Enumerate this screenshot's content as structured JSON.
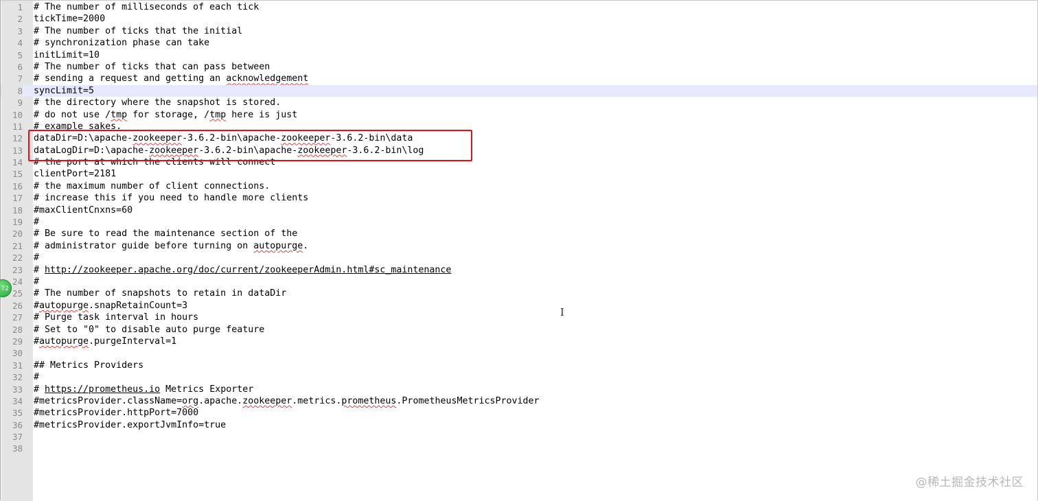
{
  "editor": {
    "current_line": 8,
    "lines": [
      {
        "n": "1",
        "text": "# The number of milliseconds of each tick"
      },
      {
        "n": "2",
        "text": "tickTime=2000"
      },
      {
        "n": "3",
        "text": "# The number of ticks that the initial"
      },
      {
        "n": "4",
        "text": "# synchronization phase can take"
      },
      {
        "n": "5",
        "text": "initLimit=10"
      },
      {
        "n": "6",
        "text": "# The number of ticks that can pass between"
      },
      {
        "n": "7",
        "text": "# sending a request and getting an acknowledgement"
      },
      {
        "n": "8",
        "text": "syncLimit=5"
      },
      {
        "n": "9",
        "text": "# the directory where the snapshot is stored."
      },
      {
        "n": "10",
        "text": "# do not use /tmp for storage, /tmp here is just"
      },
      {
        "n": "11",
        "text": "# example sakes."
      },
      {
        "n": "12",
        "text": "dataDir=D:\\apache-zookeeper-3.6.2-bin\\apache-zookeeper-3.6.2-bin\\data"
      },
      {
        "n": "13",
        "text": "dataLogDir=D:\\apache-zookeeper-3.6.2-bin\\apache-zookeeper-3.6.2-bin\\log"
      },
      {
        "n": "14",
        "text": "# the port at which the clients will connect"
      },
      {
        "n": "15",
        "text": "clientPort=2181"
      },
      {
        "n": "16",
        "text": "# the maximum number of client connections."
      },
      {
        "n": "17",
        "text": "# increase this if you need to handle more clients"
      },
      {
        "n": "18",
        "text": "#maxClientCnxns=60"
      },
      {
        "n": "19",
        "text": "#"
      },
      {
        "n": "20",
        "text": "# Be sure to read the maintenance section of the"
      },
      {
        "n": "21",
        "text": "# administrator guide before turning on autopurge."
      },
      {
        "n": "22",
        "text": "#"
      },
      {
        "n": "23",
        "text": "# http://zookeeper.apache.org/doc/current/zookeeperAdmin.html#sc_maintenance"
      },
      {
        "n": "24",
        "text": "#"
      },
      {
        "n": "25",
        "text": "# The number of snapshots to retain in dataDir"
      },
      {
        "n": "26",
        "text": "#autopurge.snapRetainCount=3"
      },
      {
        "n": "27",
        "text": "# Purge task interval in hours"
      },
      {
        "n": "28",
        "text": "# Set to \"0\" to disable auto purge feature"
      },
      {
        "n": "29",
        "text": "#autopurge.purgeInterval=1"
      },
      {
        "n": "30",
        "text": ""
      },
      {
        "n": "31",
        "text": "## Metrics Providers"
      },
      {
        "n": "32",
        "text": "#"
      },
      {
        "n": "33",
        "text": "# https://prometheus.io Metrics Exporter"
      },
      {
        "n": "34",
        "text": "#metricsProvider.className=org.apache.zookeeper.metrics.prometheus.PrometheusMetricsProvider"
      },
      {
        "n": "35",
        "text": "#metricsProvider.httpPort=7000"
      },
      {
        "n": "36",
        "text": "#metricsProvider.exportJvmInfo=true"
      },
      {
        "n": "37",
        "text": ""
      },
      {
        "n": "38",
        "text": ""
      }
    ]
  },
  "side_badge": "72",
  "watermark": "@稀土掘金技术社区",
  "colors": {
    "highlight_box": "#e0101a",
    "current_line_bg": "#e8e8ff",
    "gutter_bg": "#e4e4e4",
    "line_number": "#8a8a8a",
    "spell_squiggle": "#e04040"
  }
}
